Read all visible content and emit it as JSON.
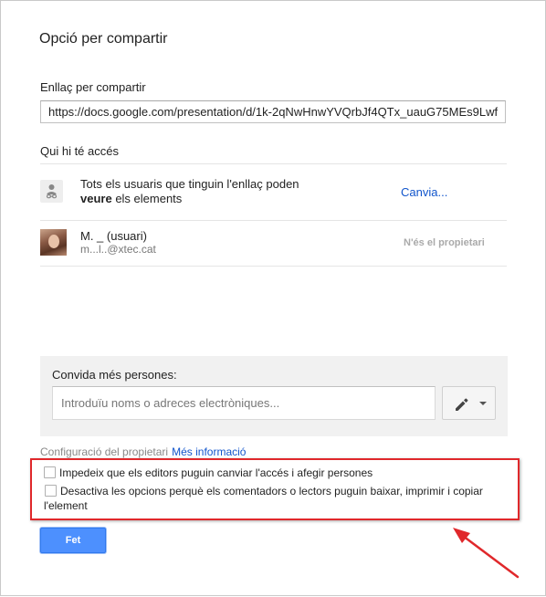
{
  "dialog": {
    "title": "Opció per compartir"
  },
  "share_link": {
    "label": "Enllaç per compartir",
    "url": "https://docs.google.com/presentation/d/1k-2qNwHnwYVQrbJf4QTx_uauG75MEs9Lwf"
  },
  "access": {
    "label": "Qui hi té accés",
    "link_row": {
      "text_line1": "Tots els usuaris que tinguin l'enllaç poden",
      "text_bold": "veure",
      "text_rest": " els elements",
      "change_label": "Canvia..."
    },
    "user_row": {
      "name": "M.                              _ (usuari)",
      "email": "m...l..@xtec.cat",
      "role": "N'és el propietari"
    }
  },
  "invite": {
    "label": "Convida més persones:",
    "placeholder": "Introduïu noms o adreces electròniques..."
  },
  "owner_settings": {
    "label": "Configuració del propietari",
    "more_info": "Més informació",
    "options": [
      {
        "label": "Impedeix que els editors puguin canviar l'accés i afegir persones",
        "checked": false
      },
      {
        "label": "Desactiva les opcions perquè els comentadors o lectors puguin baixar, imprimir i copiar l'element",
        "checked": false
      }
    ]
  },
  "done_label": "Fet",
  "colors": {
    "accent": "#4d90fe",
    "link": "#1155cc",
    "highlight": "#e0282b"
  }
}
